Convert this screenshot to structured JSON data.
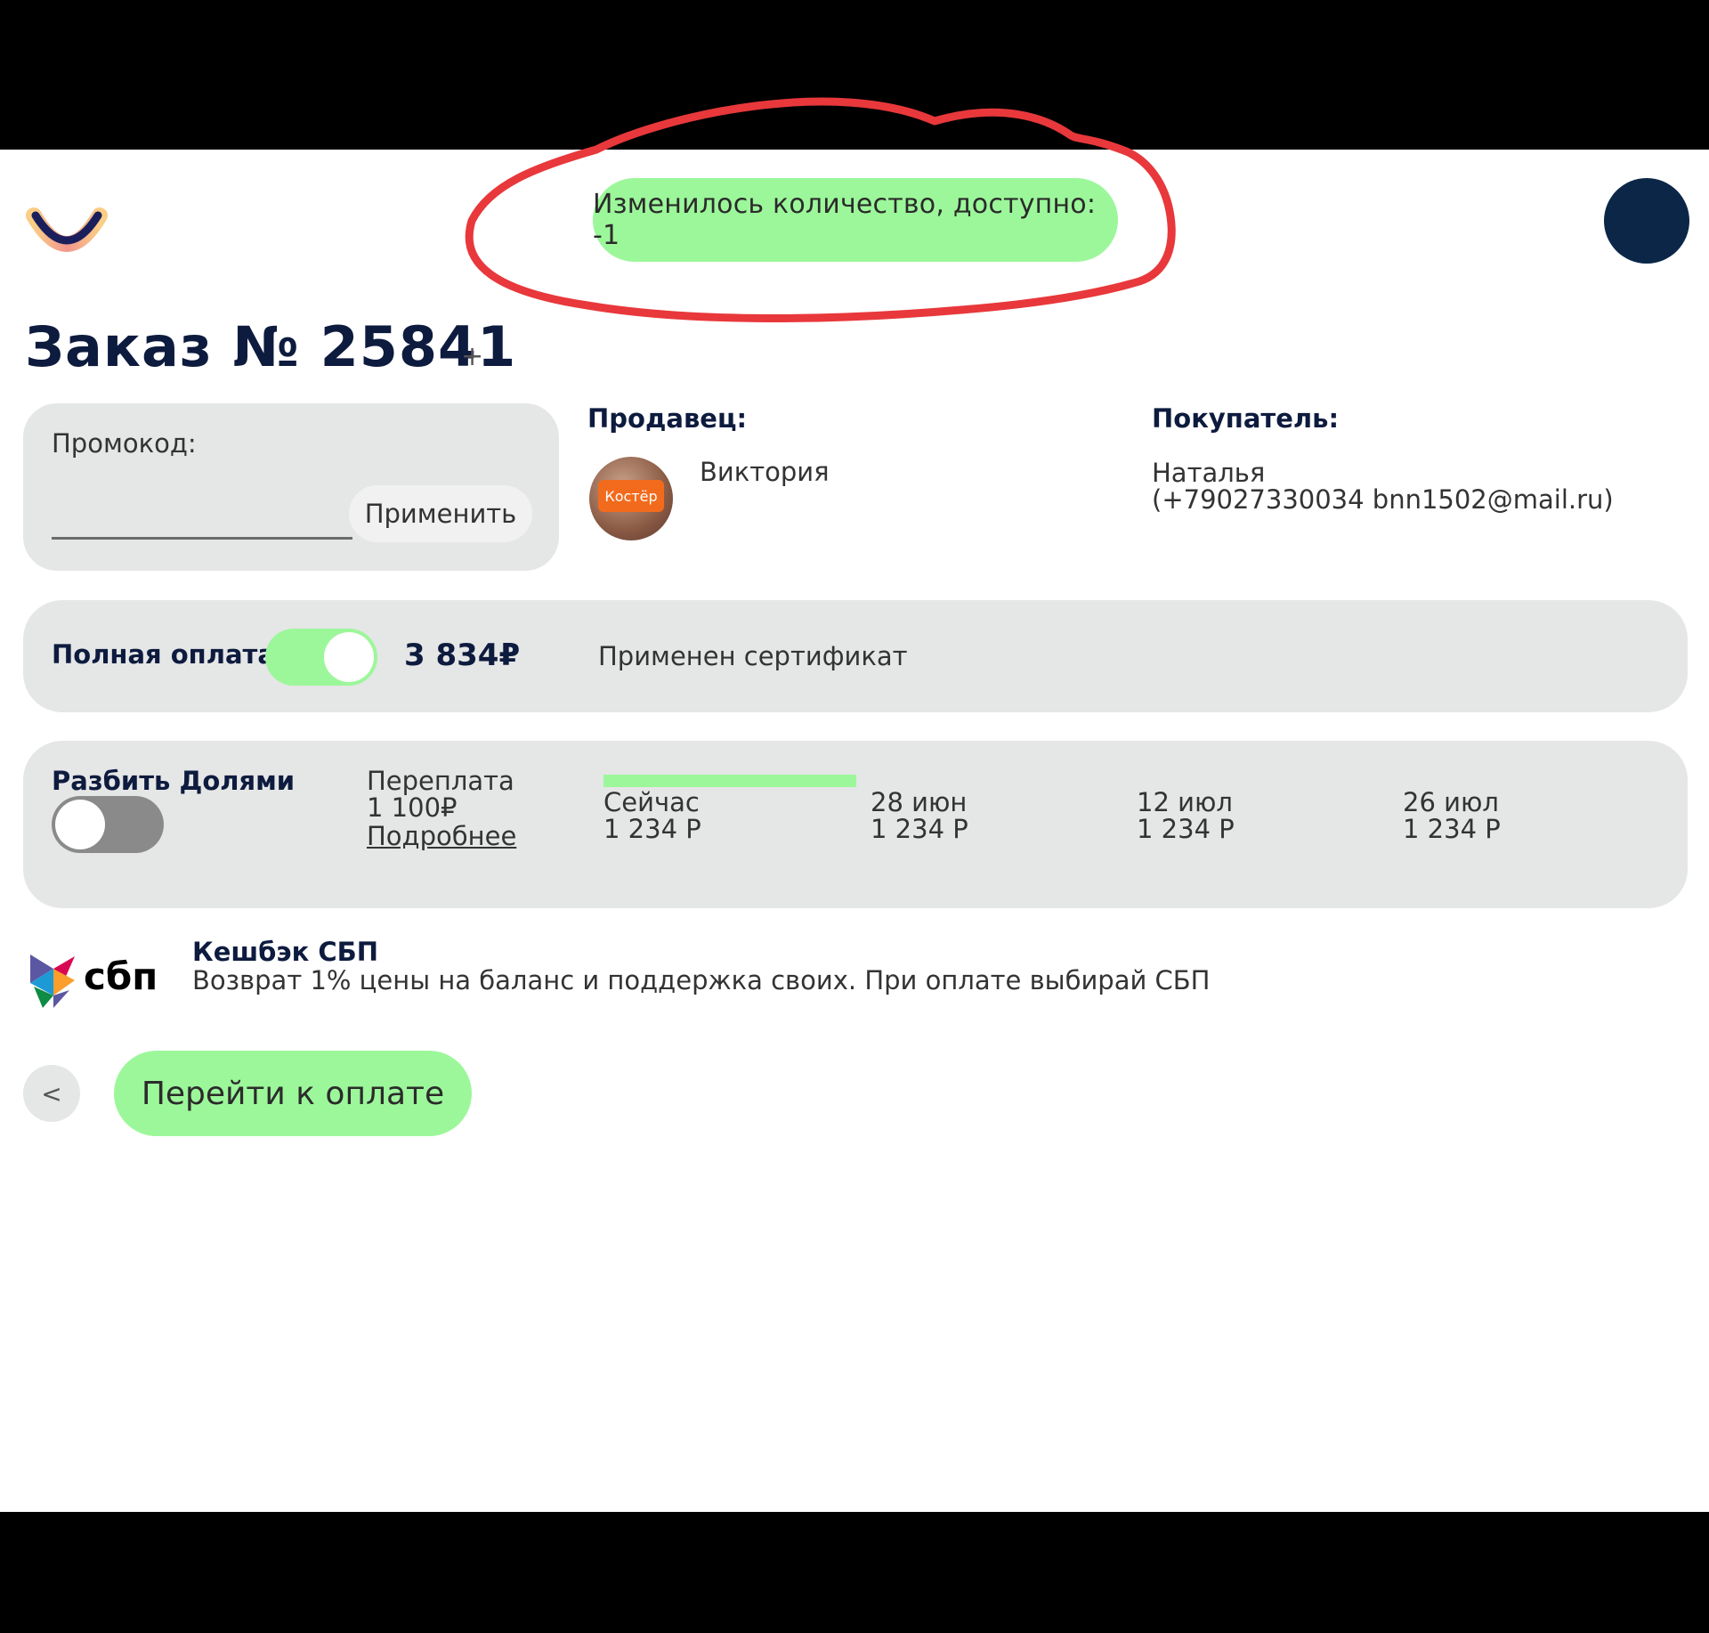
{
  "notification": {
    "text": "Изменилось количество, доступно: -1"
  },
  "order": {
    "title": "Заказ № 25841",
    "plus": "+"
  },
  "promo": {
    "label": "Промокод:",
    "value": "",
    "apply_label": "Применить"
  },
  "seller": {
    "title": "Продавец:",
    "name": "Виктория",
    "avatar_text": "Костёр"
  },
  "buyer": {
    "title": "Покупатель:",
    "name": "Наталья",
    "contact": "(+79027330034 bnn1502@mail.ru)"
  },
  "full_payment": {
    "label": "Полная оплата",
    "enabled": true,
    "amount": "3 834₽",
    "certificate": "Применен сертификат"
  },
  "installments": {
    "label": "Разбить Долями",
    "enabled": false,
    "overpay_label": "Переплата",
    "overpay_value": "1 100₽",
    "more_label": "Подробнее",
    "schedule": [
      {
        "date": "Сейчас",
        "amount": "1 234 Р"
      },
      {
        "date": "28 июн",
        "amount": "1 234 Р"
      },
      {
        "date": "12 июл",
        "amount": "1 234 Р"
      },
      {
        "date": "26 июл",
        "amount": "1 234 Р"
      }
    ]
  },
  "cashback": {
    "logo_text": "сбп",
    "title": "Кешбэк СБП",
    "text": "Возврат 1% цены на баланс и поддержка своих. При оплате выбирай СБП"
  },
  "actions": {
    "back_label": "<",
    "pay_label": "Перейти к оплате"
  },
  "colors": {
    "accent_green": "#9cf79a",
    "card_gray": "#e5e6e6",
    "navy": "#0d1b3e",
    "annotation_red": "#e8383b"
  }
}
